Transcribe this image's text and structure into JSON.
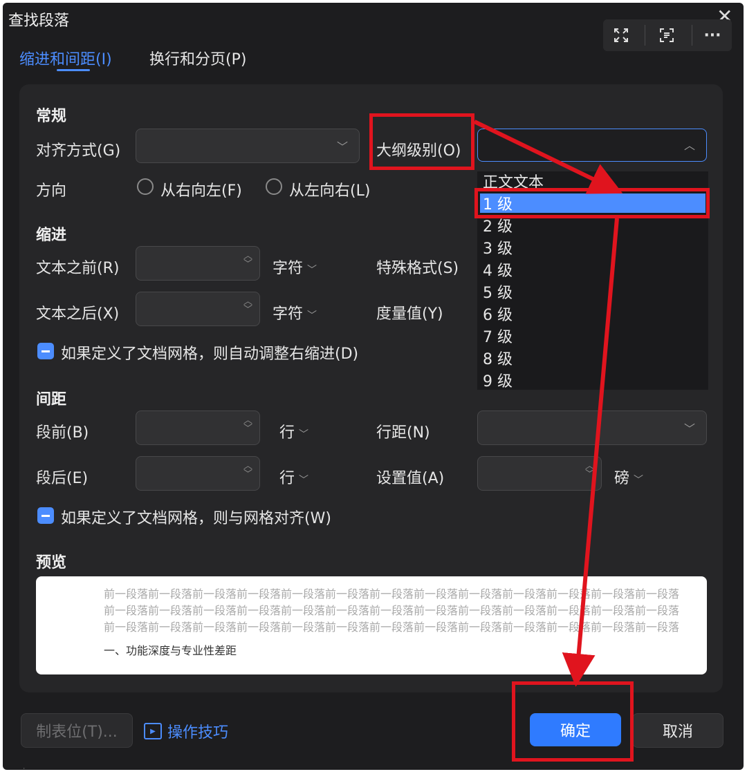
{
  "dialog": {
    "title": "查找段落"
  },
  "tabs": [
    {
      "label": "缩进和间距(I)",
      "active": true
    },
    {
      "label": "换行和分页(P)",
      "active": false
    }
  ],
  "toolbar": {
    "icons": [
      "fullscreen-icon",
      "scan-text-icon",
      "more-icon"
    ],
    "more_glyph": "···"
  },
  "general": {
    "section": "常规",
    "align_label": "对齐方式(G)",
    "align_value": "",
    "outline_label": "大纲级别(O)",
    "outline_value": "",
    "direction_label": "方向",
    "rtl_label": "从右向左(F)",
    "ltr_label": "从左向右(L)"
  },
  "indent": {
    "section": "缩进",
    "before_label": "文本之前(R)",
    "before_unit": "字符",
    "after_label": "文本之后(X)",
    "after_unit": "字符",
    "special_label": "特殊格式(S)",
    "measure_label": "度量值(Y)",
    "auto_adjust_label": "如果定义了文档网格，则自动调整右缩进(D)"
  },
  "spacing": {
    "section": "间距",
    "before_label": "段前(B)",
    "before_unit": "行",
    "after_label": "段后(E)",
    "after_unit": "行",
    "line_label": "行距(N)",
    "value_label": "设置值(A)",
    "value_unit": "磅",
    "grid_align_label": "如果定义了文档网格，则与网格对齐(W)"
  },
  "preview": {
    "section": "预览",
    "prev_line": "前一段落前一段落前一段落前一段落前一段落前一段落前一段落前一段落前一段落前一段落前一段落前一段落前一段落",
    "current": "一、功能深度与专业性差距"
  },
  "outline_dropdown": {
    "options": [
      "正文文本",
      "1 级",
      "2 级",
      "3 级",
      "4 级",
      "5 级",
      "6 级",
      "7 级",
      "8 级",
      "9 级"
    ],
    "selected": "1 级"
  },
  "footer": {
    "tabs_button": "制表位(T)...",
    "tips_link": "操作技巧",
    "ok": "确定",
    "cancel": "取消"
  },
  "colors": {
    "accent": "#4c8dff",
    "annotation": "#e0141e",
    "background": "#1d1d1f"
  }
}
